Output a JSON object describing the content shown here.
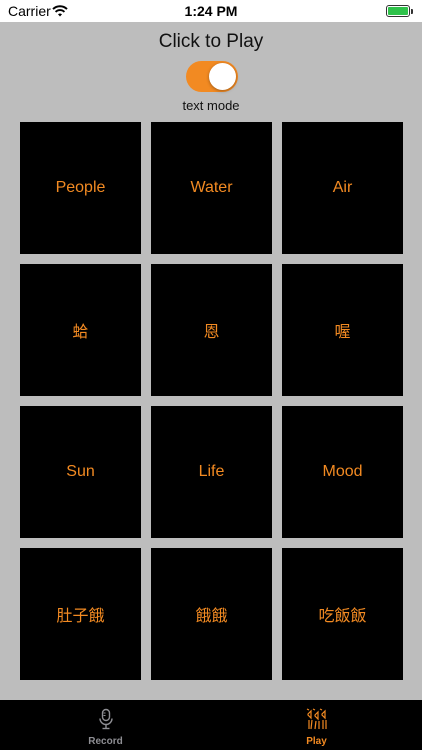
{
  "status_bar": {
    "carrier": "Carrier",
    "time": "1:24 PM",
    "battery_level": 1.0
  },
  "header": {
    "title": "Click to Play",
    "toggle_on": true,
    "toggle_label": "text mode"
  },
  "tiles": [
    "People",
    "Water",
    "Air",
    "蛤",
    "恩",
    "喔",
    "Sun",
    "Life",
    "Mood",
    "肚子餓",
    "餓餓",
    "吃飯飯"
  ],
  "tab_bar": {
    "record_label": "Record",
    "play_label": "Play",
    "selected": "Play"
  },
  "colors": {
    "accent": "#f28a22",
    "background": "#bdbdbd",
    "tile": "#000000",
    "tab_inactive": "#8e8e93"
  }
}
